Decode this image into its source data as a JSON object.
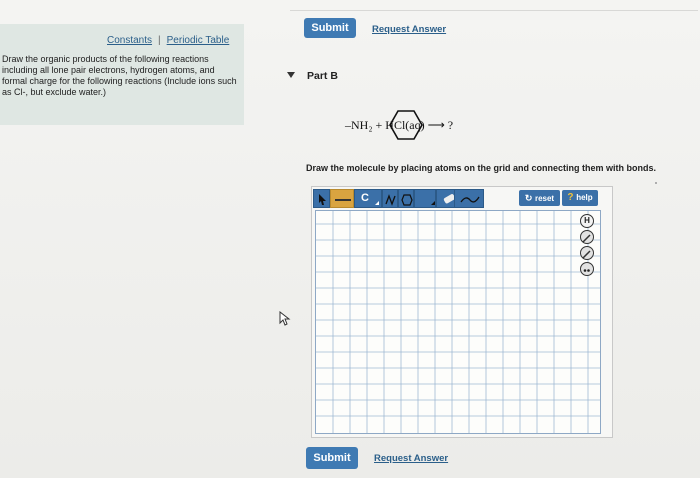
{
  "left_panel": {
    "constants_label": "Constants",
    "separator": "|",
    "periodic_table_label": "Periodic Table",
    "instructions": "Draw the organic products of the following reactions including all lone pair electrons, hydrogen atoms, and formal charge for the following reactions (Include ions such as Cl-, but exclude water.)"
  },
  "top_actions": {
    "submit_label": "Submit",
    "request_answer_label": "Request Answer"
  },
  "part": {
    "label": "Part B",
    "reaction_text": "–NH₂  +  HCl(aq)  ⟶  ?",
    "prompt": "Draw the molecule by placing atoms on the grid and connecting them with bonds."
  },
  "editor": {
    "reset_label": "reset",
    "help_label": "help",
    "carbon_label": "C",
    "side_buttons": [
      "H",
      "charge-plus",
      "charge-minus",
      "lone-pair"
    ],
    "accent_color": "#3b70a8"
  },
  "bottom_actions": {
    "submit_label": "Submit",
    "request_answer_label": "Request Answer"
  }
}
